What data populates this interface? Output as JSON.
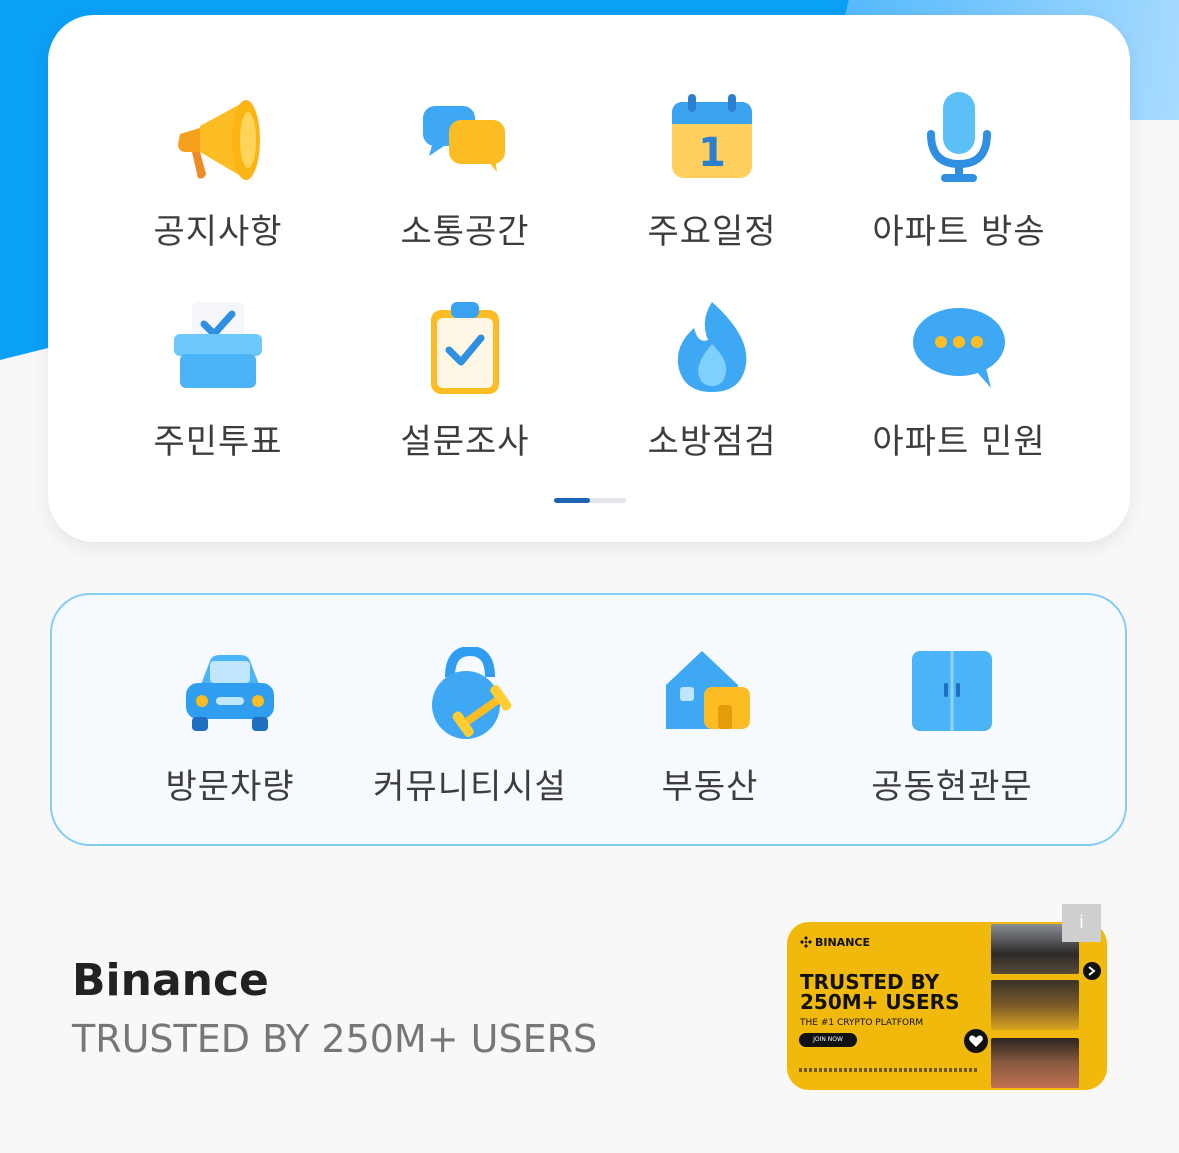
{
  "menu_primary": [
    {
      "label": "공지사항",
      "icon": "megaphone-icon"
    },
    {
      "label": "소통공간",
      "icon": "chat-bubbles-icon"
    },
    {
      "label": "주요일정",
      "icon": "calendar-icon"
    },
    {
      "label": "아파트 방송",
      "icon": "microphone-icon"
    },
    {
      "label": "주민투표",
      "icon": "ballot-box-icon"
    },
    {
      "label": "설문조사",
      "icon": "clipboard-check-icon"
    },
    {
      "label": "소방점검",
      "icon": "fire-icon"
    },
    {
      "label": "아파트 민원",
      "icon": "speech-bubble-icon"
    }
  ],
  "menu_secondary": [
    {
      "label": "방문차량",
      "icon": "car-icon"
    },
    {
      "label": "커뮤니티시설",
      "icon": "kettlebell-icon"
    },
    {
      "label": "부동산",
      "icon": "house-icon"
    },
    {
      "label": "공동현관문",
      "icon": "door-icon"
    }
  ],
  "calendar_day": "1",
  "pager": {
    "pages": 2,
    "current": 1
  },
  "ad": {
    "title": "Binance",
    "subtitle": "TRUSTED BY 250M+ USERS",
    "brand": "BINANCE",
    "headline": "TRUSTED BY 250M+ USERS",
    "tagline": "THE #1 CRYPTO PLATFORM",
    "cta": "JOIN NOW",
    "info": "i"
  },
  "colors": {
    "primary_blue": "#0aa0f6",
    "accent_yellow": "#f0b90b",
    "border_blue": "#84ccf4",
    "pager_active": "#1d64b5"
  }
}
